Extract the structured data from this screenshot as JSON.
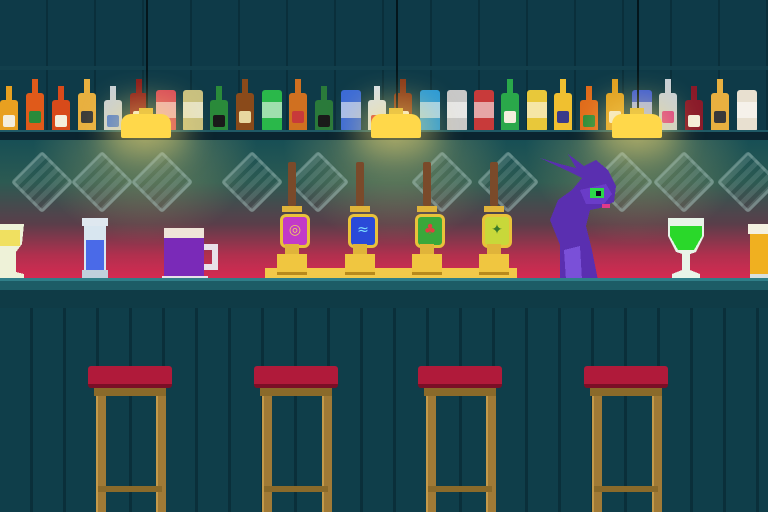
{
  "scene": {
    "colors": {
      "wall": "#0e3a48",
      "counter": "#1c5c66",
      "glow_pink": "#d92a52",
      "lamp": "#ffd84a",
      "stool_seat": "#b01a3a",
      "dragon": "#6a3cc8"
    },
    "lamps": 3,
    "taps": [
      {
        "badge_color": "#c23ac8",
        "icon": "swirl-icon"
      },
      {
        "badge_color": "#2a4ad8",
        "icon": "water-icon"
      },
      {
        "badge_color": "#3aa83a",
        "icon": "clover-icon"
      },
      {
        "badge_color": "#c8d83a",
        "icon": "lemon-icon"
      }
    ],
    "stools": 4,
    "character": "purple-dragon-bartender"
  }
}
